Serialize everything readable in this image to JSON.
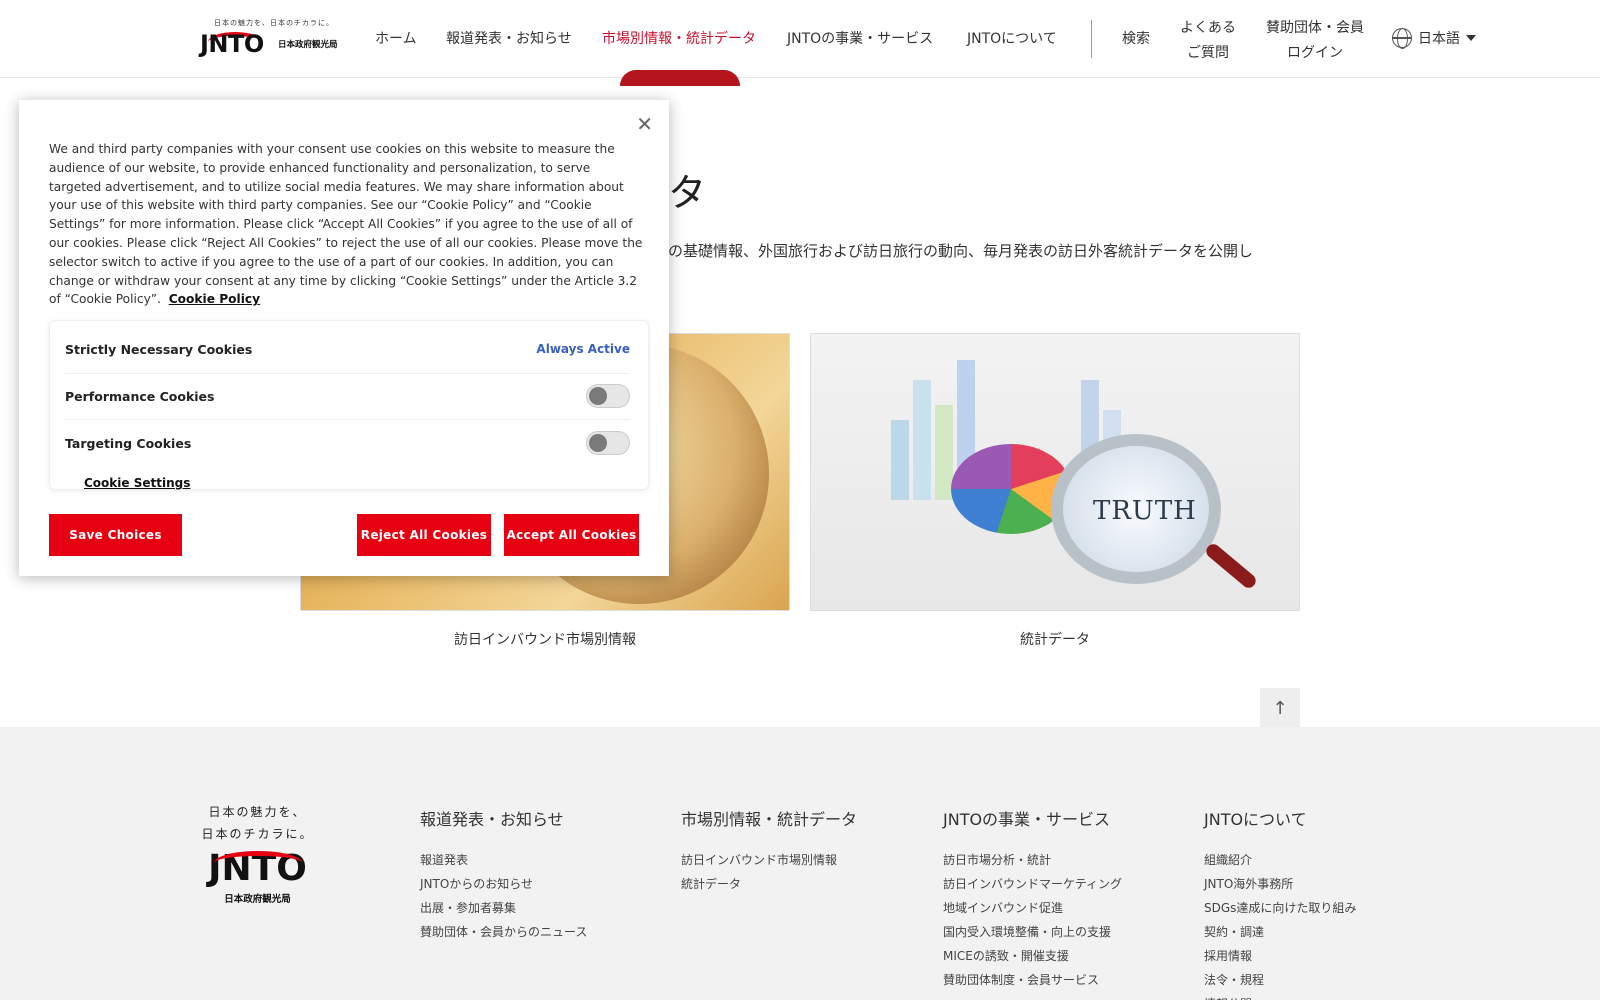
{
  "header": {
    "logo": {
      "tagline": "日本の魅力を、日本のチカラに。",
      "wordmark": "JNTO",
      "org_name": "日本政府観光局"
    },
    "nav": [
      {
        "label": "ホーム",
        "active": false
      },
      {
        "label": "報道発表・お知らせ",
        "active": false
      },
      {
        "label": "市場別情報・統計データ",
        "active": true
      },
      {
        "label": "JNTOの事業・サービス",
        "active": false
      },
      {
        "label": "JNTOについて",
        "active": false
      }
    ],
    "search_label": "検索",
    "faq": {
      "line1": "よくある",
      "line2": "ご質問"
    },
    "member_login": {
      "line1": "賛助団体・会員",
      "line2": "ログイン"
    },
    "language": "日本語"
  },
  "main": {
    "heading_visible": "ータ",
    "description_visible": "の基礎情報、外国旅行および訪日旅行の動向、毎月発表の訪日外客統計データを公開し",
    "cards": [
      {
        "caption": "訪日インバウンド市場別情報",
        "image": "globe-photo"
      },
      {
        "caption": "統計データ",
        "image": "statistics-magnifier-photo",
        "image_text": "TRUTH"
      }
    ],
    "to_top_icon": "arrow-up-icon"
  },
  "cookie_banner": {
    "body_text": "We and third party companies with your consent use cookies on this website to measure the audience of our website, to provide enhanced functionality and personalization, to serve targeted advertisement, and to utilize social media features. We may share information about your use of this website with third party companies. See our “Cookie Policy” and “Cookie Settings” for more information. Please click “Accept All Cookies” if you agree to the use of all of our cookies. Please click “Reject All Cookies” to reject the use of all our cookies. Please move the selector switch to active if you agree to the use of a part of our cookies. In addition, you can change or withdraw your consent at any time by clicking “Cookie Settings” under the Article 3.2 of “Cookie Policy”.",
    "policy_link": "Cookie Policy",
    "preferences": [
      {
        "label": "Strictly Necessary Cookies",
        "status": "Always Active"
      },
      {
        "label": "Performance Cookies",
        "enabled": false
      },
      {
        "label": "Targeting Cookies",
        "enabled": false
      }
    ],
    "settings_link": "Cookie Settings",
    "buttons": {
      "save": "Save Choices",
      "reject": "Reject All Cookies",
      "accept": "Accept All Cookies"
    },
    "accent_color": "#e60012"
  },
  "footer": {
    "logo": {
      "tagline_line1": "日本の魅力を、",
      "tagline_line2": "日本のチカラに。",
      "wordmark": "JNTO",
      "org_name": "日本政府観光局"
    },
    "columns": [
      {
        "title": "報道発表・お知らせ",
        "links": [
          "報道発表",
          "JNTOからのお知らせ",
          "出展・参加者募集",
          "賛助団体・会員からのニュース"
        ]
      },
      {
        "title": "市場別情報・統計データ",
        "links": [
          "訪日インバウンド市場別情報",
          "統計データ"
        ]
      },
      {
        "title": "JNTOの事業・サービス",
        "links": [
          "訪日市場分析・統計",
          "訪日インバウンドマーケティング",
          "地域インバウンド促進",
          "国内受入環境整備・向上の支援",
          "MICEの誘致・開催支援",
          "賛助団体制度・会員サービス"
        ]
      },
      {
        "title": "JNTOについて",
        "links": [
          "組織紹介",
          "JNTO海外事務所",
          "SDGs達成に向けた取り組み",
          "契約・調達",
          "採用情報",
          "法令・規程",
          "情報公開"
        ]
      }
    ]
  }
}
